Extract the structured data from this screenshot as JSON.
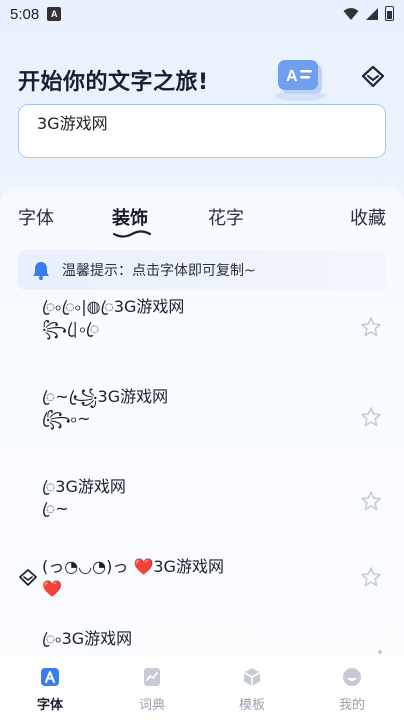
{
  "status_bar": {
    "time": "5:08",
    "notification_badge": "A"
  },
  "header": {
    "title": "开始你的文字之旅!"
  },
  "hero_icon": {
    "label": "A"
  },
  "input": {
    "value": "3G游戏网"
  },
  "tabs": [
    {
      "label": "字体",
      "active": false
    },
    {
      "label": "装饰",
      "active": true
    },
    {
      "label": "花字",
      "active": false
    },
    {
      "label": "收藏",
      "active": false
    }
  ],
  "tip": {
    "text": "温馨提示：点击字体即可复制~"
  },
  "items": [
    {
      "text": "ꦿ৹ꦿ৹|◍ꦿ3G游戏网\n꧂|ꦿ৹ꦿ",
      "vip": false
    },
    {
      "text": "ꦿ~꧁ꦿ3G游戏网\n꧂ꦿ৹~",
      "vip": false
    },
    {
      "text": "ꦿ3G游戏网\nꦿ~",
      "vip": false
    },
    {
      "text": "(っ◔◡◔)っ ❤️3G游戏网\n❤️",
      "vip": true
    },
    {
      "text": "ꦿ৹3G游戏网",
      "vip": false
    }
  ],
  "nav": [
    {
      "label": "字体",
      "icon": "font-icon",
      "active": true
    },
    {
      "label": "词典",
      "icon": "dictionary-icon",
      "active": false
    },
    {
      "label": "模板",
      "icon": "template-icon",
      "active": false
    },
    {
      "label": "我的",
      "icon": "profile-icon",
      "active": false
    }
  ],
  "colors": {
    "accent": "#3b7cf0",
    "input_border": "#a9c8f3",
    "icon_gray": "#c6cbd3"
  }
}
